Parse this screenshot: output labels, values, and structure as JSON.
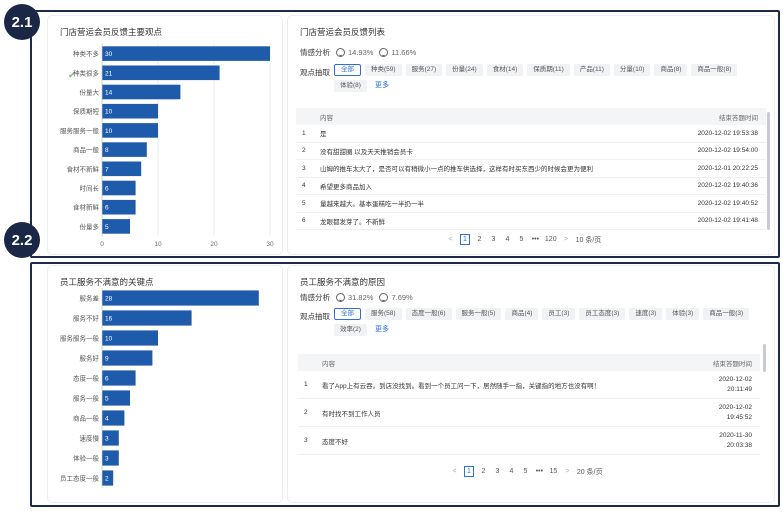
{
  "badges": {
    "s1": "2.1",
    "s2": "2.2"
  },
  "section1": {
    "chart": {
      "title": "门店营运会员反馈主要观点",
      "check_icon": "check-icon"
    },
    "feedback": {
      "title": "门店营运会员反馈列表",
      "sentiment_label": "情感分析",
      "positive": "14.93%",
      "negative": "11.66%",
      "keyword_label": "观点抽取",
      "tags": [
        "全部",
        "种类(59)",
        "服务(27)",
        "份量(24)",
        "食材(14)",
        "保质期(11)",
        "产品(11)",
        "分量(10)",
        "商品(8)",
        "商品一般(8)",
        "体验(8)"
      ],
      "more": "更多",
      "columns": {
        "content": "内容",
        "time": "结束答题时间"
      },
      "rows": [
        {
          "idx": "1",
          "content": "是",
          "time": "2020-12-02 19:53:38"
        },
        {
          "idx": "2",
          "content": "没有甜甜圈 以及天天推销会员卡",
          "time": "2020-12-02 19:54:00"
        },
        {
          "idx": "3",
          "content": "山姆的推车太大了，是否可以有稍微小一点的推车供选择，这样有时买东西少的时候会更为便利",
          "time": "2020-12-01 20:22:25"
        },
        {
          "idx": "4",
          "content": "希望更多商品加入",
          "time": "2020-12-02 19:40:36"
        },
        {
          "idx": "5",
          "content": "量越来越大。基本蛋糕吃一半扔一半",
          "time": "2020-12-02 19:40:52"
        },
        {
          "idx": "6",
          "content": "龙眼都发芽了。不新鲜",
          "time": "2020-12-02 19:41:48"
        }
      ],
      "pager": {
        "prev": "<",
        "pages": [
          "1",
          "2",
          "3",
          "4",
          "5"
        ],
        "dots": "•••",
        "last": "120",
        "size": "10 条/页",
        "next": ">"
      }
    }
  },
  "section2": {
    "chart": {
      "title": "员工服务不满意的关键点"
    },
    "feedback": {
      "title": "员工服务不满意的原因",
      "sentiment_label": "情感分析",
      "positive": "31.82%",
      "negative": "7.69%",
      "keyword_label": "观点抽取",
      "tags": [
        "全部",
        "服务(58)",
        "态度一般(6)",
        "服务一般(5)",
        "商品(4)",
        "员工(3)",
        "员工态度(3)",
        "速度(3)",
        "体验(3)",
        "商品一般(3)",
        "效率(2)"
      ],
      "more": "更多",
      "columns": {
        "content": "内容",
        "time": "结束答题时间"
      },
      "rows": [
        {
          "idx": "1",
          "content": "看了App上有云吞。到店没找到。看到一个员工问一下，居然随手一指，关键指的地方也没有啊！",
          "date": "2020-12-02",
          "clock": "20:11:49"
        },
        {
          "idx": "2",
          "content": "有时找不到工作人员",
          "date": "2020-12-02",
          "clock": "19:45:52"
        },
        {
          "idx": "3",
          "content": "态度不好",
          "date": "2020-11-30",
          "clock": "20:03:38"
        }
      ],
      "pager": {
        "prev": "<",
        "pages": [
          "1",
          "2",
          "3",
          "4",
          "5"
        ],
        "dots": "•••",
        "last": "15",
        "size": "20 条/页",
        "next": ">"
      }
    }
  },
  "chart_data": [
    {
      "type": "bar",
      "orientation": "horizontal",
      "title": "门店营运会员反馈主要观点",
      "categories": [
        "种类不多",
        "种类很多",
        "份量大",
        "保质期短",
        "服务服务一般",
        "商品一般",
        "食材不新鲜",
        "时间长",
        "食材新鲜",
        "份量多"
      ],
      "values": [
        30,
        21,
        14,
        10,
        10,
        8,
        7,
        6,
        6,
        5
      ],
      "xticks": [
        "0",
        "10",
        "20",
        "30"
      ],
      "xlim": [
        0,
        30
      ],
      "color": "#1f5bab"
    },
    {
      "type": "bar",
      "orientation": "horizontal",
      "title": "员工服务不满意的关键点",
      "categories": [
        "服务差",
        "服务不好",
        "服务服务一般",
        "服务好",
        "态度一般",
        "服务一般",
        "商品一般",
        "速度慢",
        "体验一般",
        "员工态度一般"
      ],
      "values": [
        28,
        16,
        10,
        9,
        6,
        5,
        4,
        3,
        3,
        2
      ],
      "xlim": [
        0,
        30
      ],
      "color": "#1f5bab"
    }
  ]
}
